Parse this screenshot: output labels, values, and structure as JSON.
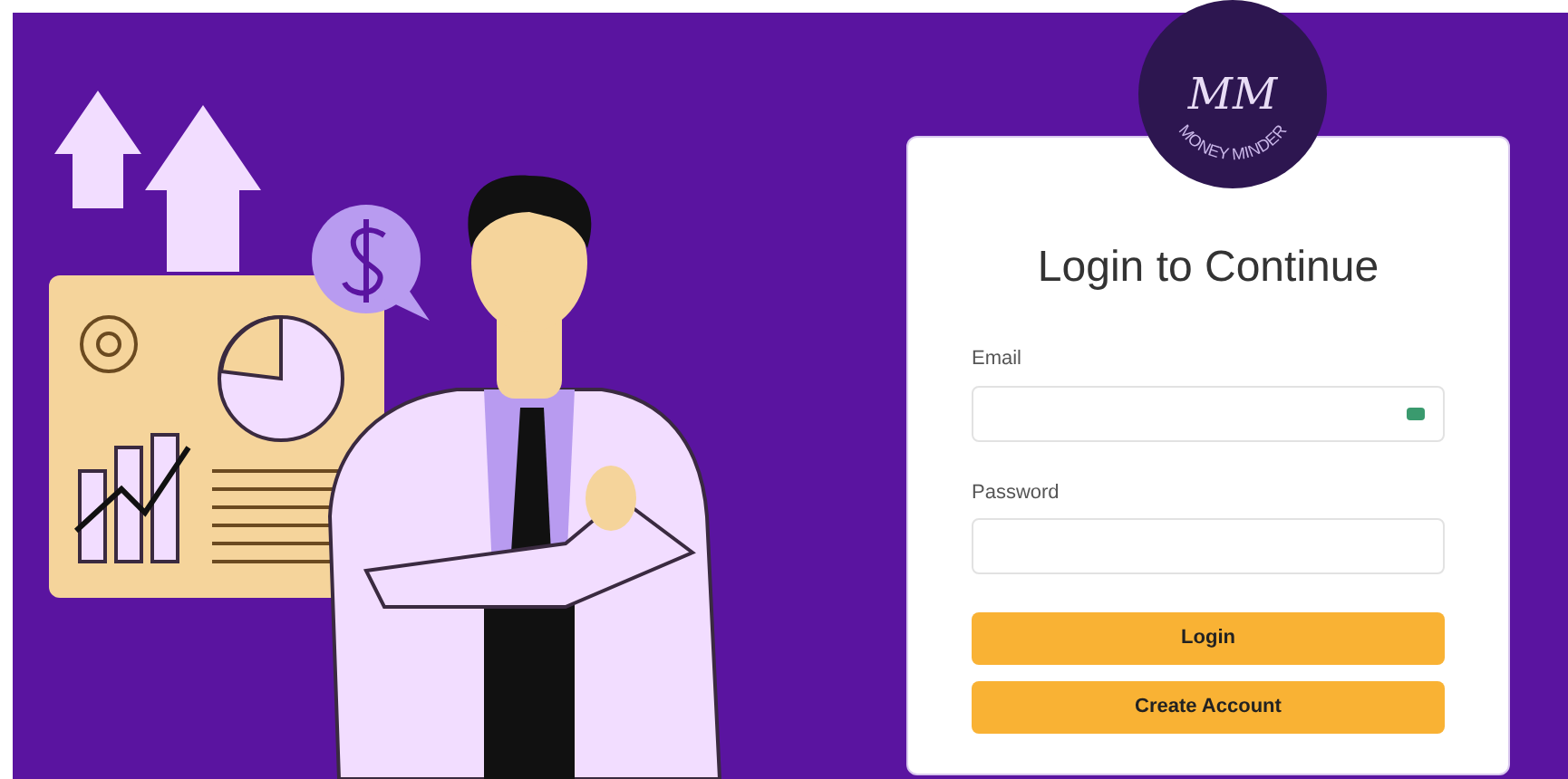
{
  "logo": {
    "monogram": "MM",
    "name": "MONEY MINDER"
  },
  "login_card": {
    "title": "Login to Continue",
    "fields": [
      {
        "label": "Email",
        "kind": "email"
      },
      {
        "label": "Password",
        "kind": "password"
      }
    ],
    "buttons": [
      "Login",
      "Create Account"
    ]
  }
}
